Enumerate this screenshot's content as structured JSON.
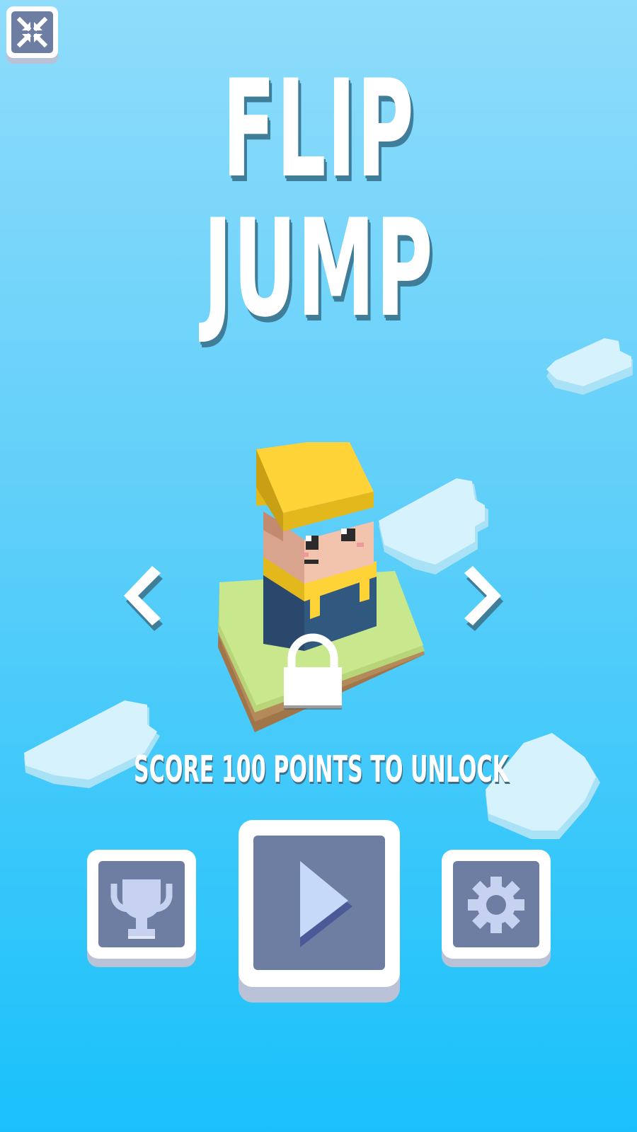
{
  "title": {
    "line1": "FLIP",
    "line2": "JUMP"
  },
  "character_select": {
    "prev_icon": "chevron-left-icon",
    "next_icon": "chevron-right-icon",
    "lock_icon": "padlock-icon",
    "unlock_hint": "SCORE 100 POINTS TO UNLOCK"
  },
  "top_bar": {
    "minimize_icon": "compress-arrows-icon"
  },
  "bottom_buttons": {
    "leaderboard_icon": "trophy-icon",
    "play_icon": "play-icon",
    "settings_icon": "gear-icon"
  },
  "colors": {
    "sky_top": "#8fdcfb",
    "sky_bottom": "#19c1fb",
    "button_face": "#6e7ea3",
    "button_border": "#ffffff",
    "title_shadow": "#3f7d99",
    "character_hat": "#fdd338",
    "character_body": "#31587f",
    "grass": "#c9e78d",
    "dirt": "#b48a5b"
  }
}
